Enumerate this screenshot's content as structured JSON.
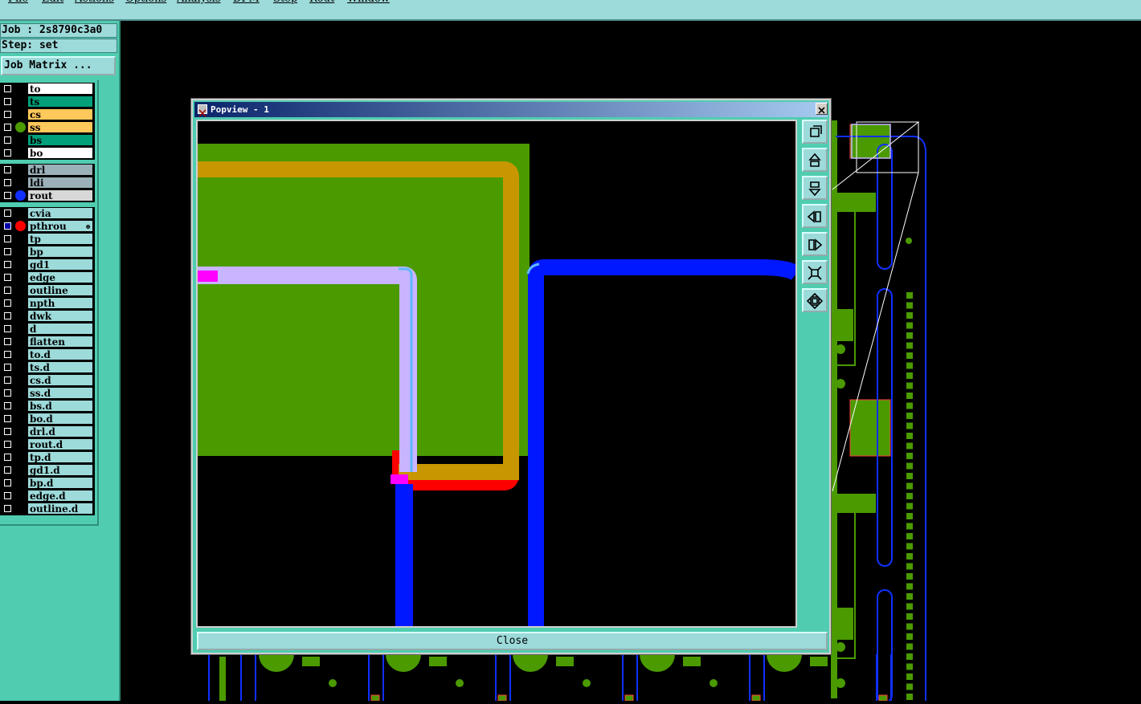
{
  "menu": [
    {
      "label": "File"
    },
    {
      "label": "Edit"
    },
    {
      "label": "Actions"
    },
    {
      "label": "Options"
    },
    {
      "label": "Analysis"
    },
    {
      "label": "DFM"
    },
    {
      "label": "Step"
    },
    {
      "label": "Rout"
    },
    {
      "label": "Window"
    }
  ],
  "job": {
    "label": "Job : 2s8790c3a0",
    "step_label": "Step: set"
  },
  "job_matrix_button": "Job Matrix ...",
  "layers": [
    {
      "name": "to",
      "bg": "#ffffff",
      "dot": ""
    },
    {
      "name": "ts",
      "bg": "#00a07a",
      "dot": ""
    },
    {
      "name": "cs",
      "bg": "#ffc85a",
      "dot": ""
    },
    {
      "name": "ss",
      "bg": "#ffc85a",
      "dot": "#4a9a00"
    },
    {
      "name": "bs",
      "bg": "#00a07a",
      "dot": ""
    },
    {
      "name": "bo",
      "bg": "#ffffff",
      "dot": ""
    },
    {
      "name": "drl",
      "bg": "#9bb0b8",
      "dot": ""
    },
    {
      "name": "ldi",
      "bg": "#9bb0b8",
      "dot": ""
    },
    {
      "name": "rout",
      "bg": "#d8d8d8",
      "dot": "#1030ff"
    },
    {
      "name": "cvia",
      "bg": "#9ddada",
      "dot": ""
    },
    {
      "name": "pthrou",
      "bg": "#9ddada",
      "dot": "#ff0000",
      "active": true,
      "flag": "⊕"
    },
    {
      "name": "tp",
      "bg": "#9ddada",
      "dot": ""
    },
    {
      "name": "bp",
      "bg": "#9ddada",
      "dot": ""
    },
    {
      "name": "gd1",
      "bg": "#9ddada",
      "dot": ""
    },
    {
      "name": "edge",
      "bg": "#9ddada",
      "dot": ""
    },
    {
      "name": "outline",
      "bg": "#9ddada",
      "dot": ""
    },
    {
      "name": "npth",
      "bg": "#9ddada",
      "dot": ""
    },
    {
      "name": "dwk",
      "bg": "#9ddada",
      "dot": ""
    },
    {
      "name": "d",
      "bg": "#9ddada",
      "dot": ""
    },
    {
      "name": "flatten",
      "bg": "#9ddada",
      "dot": ""
    },
    {
      "name": "to.d",
      "bg": "#9ddada",
      "dot": ""
    },
    {
      "name": "ts.d",
      "bg": "#9ddada",
      "dot": ""
    },
    {
      "name": "cs.d",
      "bg": "#9ddada",
      "dot": ""
    },
    {
      "name": "ss.d",
      "bg": "#9ddada",
      "dot": ""
    },
    {
      "name": "bs.d",
      "bg": "#9ddada",
      "dot": ""
    },
    {
      "name": "bo.d",
      "bg": "#9ddada",
      "dot": ""
    },
    {
      "name": "drl.d",
      "bg": "#9ddada",
      "dot": ""
    },
    {
      "name": "rout.d",
      "bg": "#9ddada",
      "dot": ""
    },
    {
      "name": "tp.d",
      "bg": "#9ddada",
      "dot": ""
    },
    {
      "name": "gd1.d",
      "bg": "#9ddada",
      "dot": ""
    },
    {
      "name": "bp.d",
      "bg": "#9ddada",
      "dot": ""
    },
    {
      "name": "edge.d",
      "bg": "#9ddada",
      "dot": ""
    },
    {
      "name": "outline.d",
      "bg": "#9ddada",
      "dot": ""
    }
  ],
  "popview": {
    "title": "Popview - 1",
    "close_label": "Close",
    "tools": [
      {
        "icon": "zoom-home-icon"
      },
      {
        "icon": "pan-up-icon"
      },
      {
        "icon": "pan-down-icon"
      },
      {
        "icon": "pan-left-icon"
      },
      {
        "icon": "pan-right-icon"
      },
      {
        "icon": "zoom-fit-icon"
      },
      {
        "icon": "zoom-center-icon"
      }
    ]
  },
  "colors": {
    "ui_teal": "#50cdb0",
    "ui_cyan": "#9ddada",
    "copper_green": "#4a9a00",
    "mask_orange": "#c89600",
    "route_blue": "#0018ff",
    "trace_red": "#ff0000",
    "trace_magenta": "#ff00ff",
    "trace_lavender": "#c8b4ff"
  }
}
